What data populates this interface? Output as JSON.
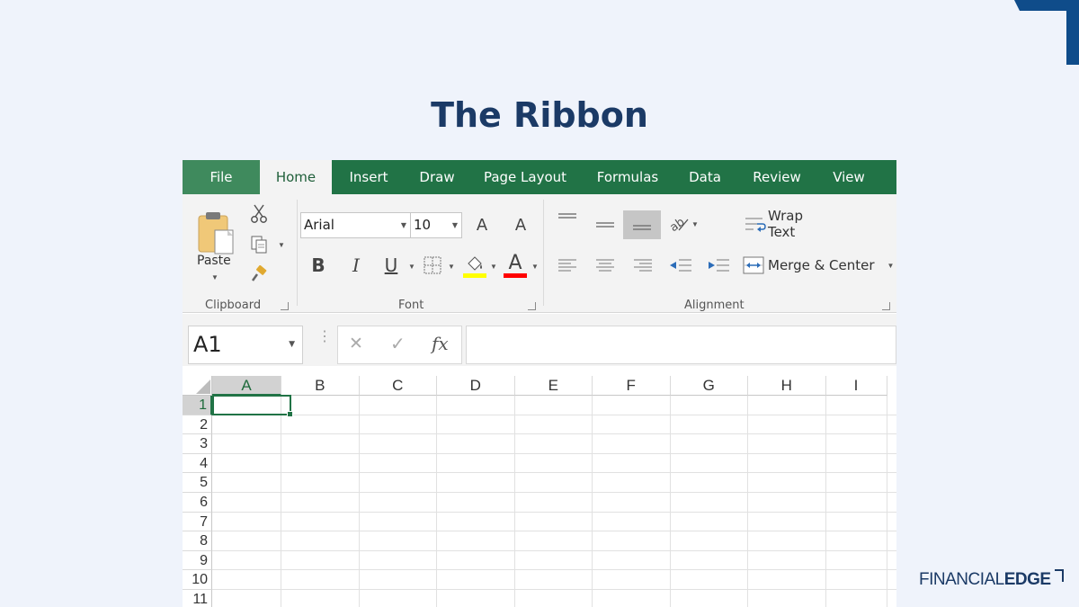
{
  "slide": {
    "title": "The Ribbon"
  },
  "brand": {
    "logo_regular": "FINANCIAL",
    "logo_bold": "EDGE",
    "accent": "#0f4c8a",
    "title_color": "#1b3a66"
  },
  "excel": {
    "accent": "#217346",
    "tabs": [
      {
        "label": "File"
      },
      {
        "label": "Home",
        "active": true
      },
      {
        "label": "Insert"
      },
      {
        "label": "Draw"
      },
      {
        "label": "Page Layout"
      },
      {
        "label": "Formulas"
      },
      {
        "label": "Data"
      },
      {
        "label": "Review"
      },
      {
        "label": "View"
      }
    ],
    "clipboard": {
      "group_label": "Clipboard",
      "paste_label": "Paste",
      "icons": [
        "paste-icon",
        "cut-icon",
        "copy-icon",
        "format-painter-icon"
      ]
    },
    "font": {
      "group_label": "Font",
      "font_name": "Arial",
      "font_size": "10",
      "bold": "B",
      "italic": "I",
      "underline": "U",
      "grow": "A",
      "shrink": "A",
      "font_color_glyph": "A",
      "fill_color": "#ffff00",
      "font_color": "#ff0000"
    },
    "alignment": {
      "group_label": "Alignment",
      "wrap_text": "Wrap Text",
      "merge_center": "Merge & Center"
    },
    "formula_bar": {
      "name_box": "A1",
      "fx": "fx",
      "cancel": "✕",
      "enter": "✓",
      "formula": ""
    },
    "sheet": {
      "columns": [
        "A",
        "B",
        "C",
        "D",
        "E",
        "F",
        "G",
        "H",
        "I"
      ],
      "rows": [
        "1",
        "2",
        "3",
        "4",
        "5",
        "6",
        "7",
        "8",
        "9",
        "10",
        "11"
      ],
      "selected_column": "A",
      "selected_row": "1"
    }
  }
}
